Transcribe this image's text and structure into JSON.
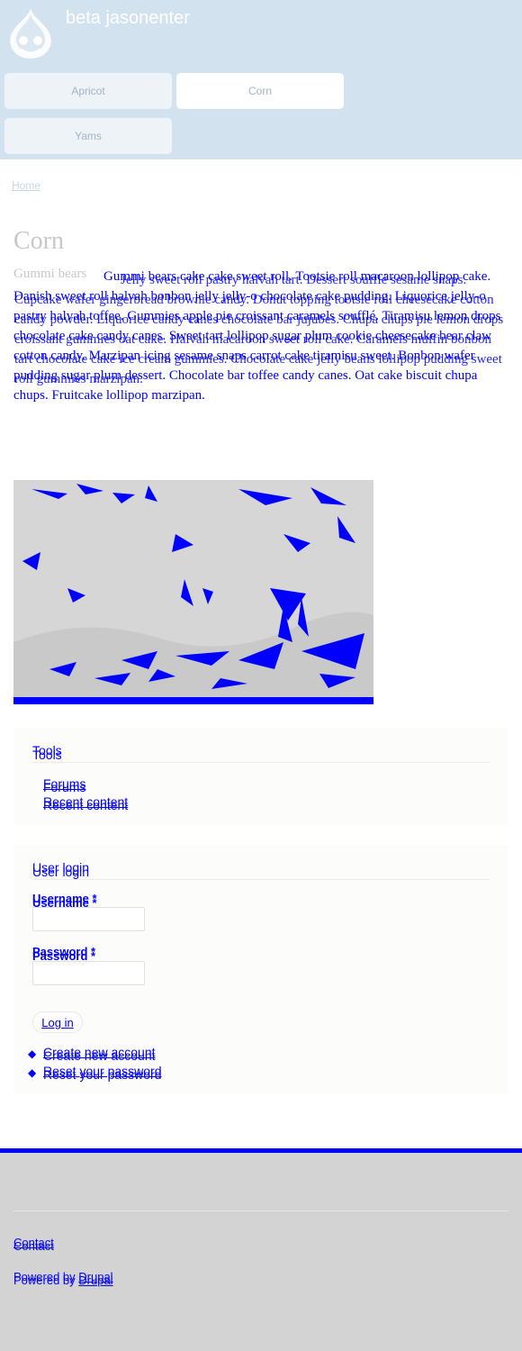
{
  "site": {
    "name": "beta jasonenter"
  },
  "nav": {
    "tabs": [
      {
        "label": "Apricot",
        "active": false
      },
      {
        "label": "Corn",
        "active": true
      },
      {
        "label": "Yams",
        "active": false
      }
    ]
  },
  "breadcrumb": {
    "home": "Home"
  },
  "page": {
    "title": "Corn",
    "body_lead": "Gummi bears",
    "body_a": "Gummi bears cake cake sweet roll. Tootsie roll macaroon lollipop cake. Danish sweet roll halvah bonbon jelly jelly-o chocolate cake pudding. Liquorice jelly-o pastry halvah toffee. Gummies apple pie croissant caramels soufflé. Tiramisu lemon drops chocolate cake candy canes. Sweet tart lollipop sugar plum cookie cheesecake bear claw cotton candy. Marzipan icing sesame snaps carrot cake tiramisu sweet. Bonbon wafer pudding sugar plum dessert. Chocolate bar toffee candy canes. Oat cake biscuit chupa chups. Fruitcake lollipop marzipan.",
    "body_b": "Jelly sweet roll pastry halvah tart. Dessert soufflé sesame snaps. Cupcake wafer gingerbread brownie candy. Donut topping tootsie roll cheesecake cotton candy powder. Liquorice candy canes chocolate bar jujubes. Chupa chups pie lemon drops croissant gummies oat cake. Halvah macaroon sweet roll cake. Caramels muffin bonbon tart chocolate cake ice cream gummies. Chocolate cake jelly beans lollipop pudding sweet roll gummies marzipan."
  },
  "tools_block": {
    "title": "Tools",
    "links": [
      "Forums",
      "Recent content"
    ]
  },
  "login_block": {
    "title": "User login",
    "username_label": "Username *",
    "password_label": "Password *",
    "login_button": "Log in",
    "links": [
      "Create new account",
      "Reset your password"
    ]
  },
  "footer": {
    "contact": "Contact",
    "powered_prefix": "Powered by ",
    "powered_link": "Drupal"
  },
  "colors": {
    "header_bg": "#d2e2ee",
    "link": "#0000ff",
    "footer_bg": "#d3d3d3"
  }
}
